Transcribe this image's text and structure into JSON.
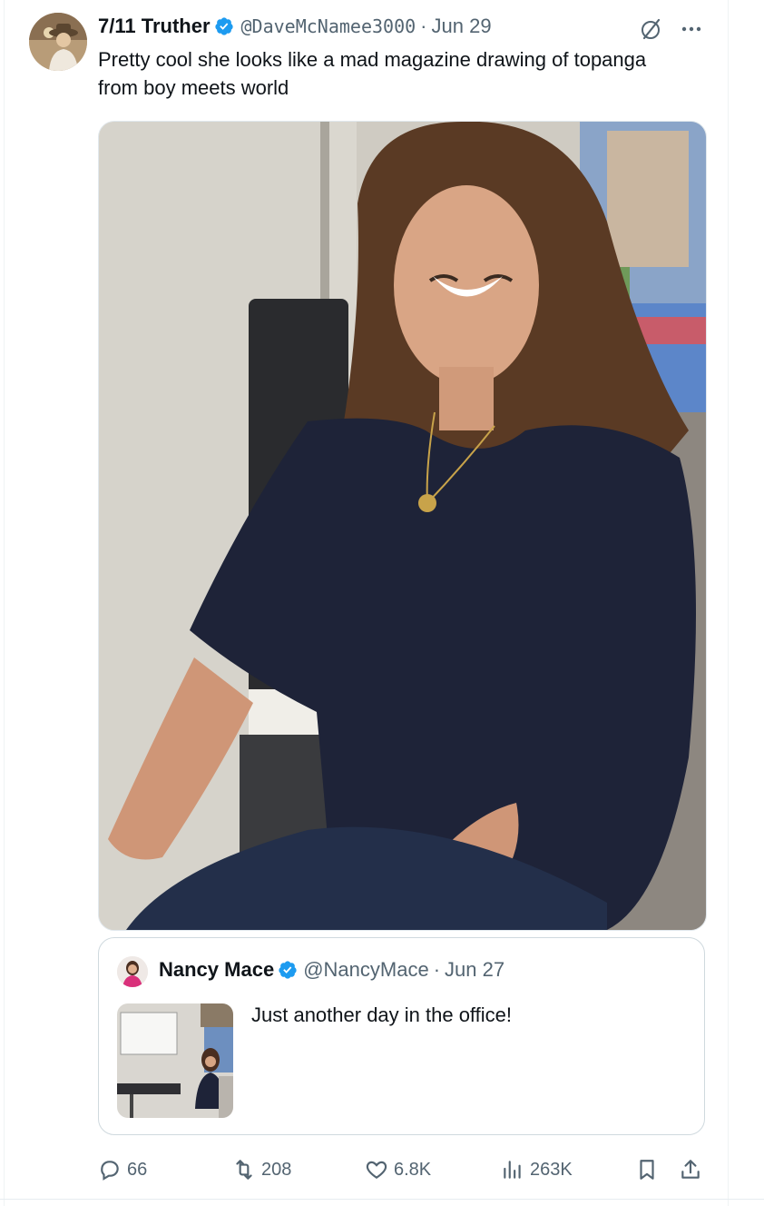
{
  "tweet": {
    "author_name": "7/11 Truther",
    "handle": "@DaveMcNamee3000",
    "separator": "·",
    "date": "Jun 29",
    "text": "Pretty cool she looks like a mad magazine drawing of topanga from boy meets world"
  },
  "quoted": {
    "author_name": "Nancy Mace",
    "handle": "@NancyMace",
    "separator": "·",
    "date": "Jun 27",
    "text": "Just another day in the office!"
  },
  "actions": {
    "replies": "66",
    "reposts": "208",
    "likes": "6.8K",
    "views": "263K"
  },
  "icons": {
    "verified": "verified-badge-icon",
    "grok": "grok-icon",
    "more": "more-icon",
    "reply": "reply-icon",
    "repost": "repost-icon",
    "like": "heart-icon",
    "views": "views-icon",
    "bookmark": "bookmark-icon",
    "share": "share-icon"
  },
  "colors": {
    "text_primary": "#0f1419",
    "text_secondary": "#536471",
    "verified_blue": "#1d9bf0",
    "border": "#cfd9de"
  }
}
